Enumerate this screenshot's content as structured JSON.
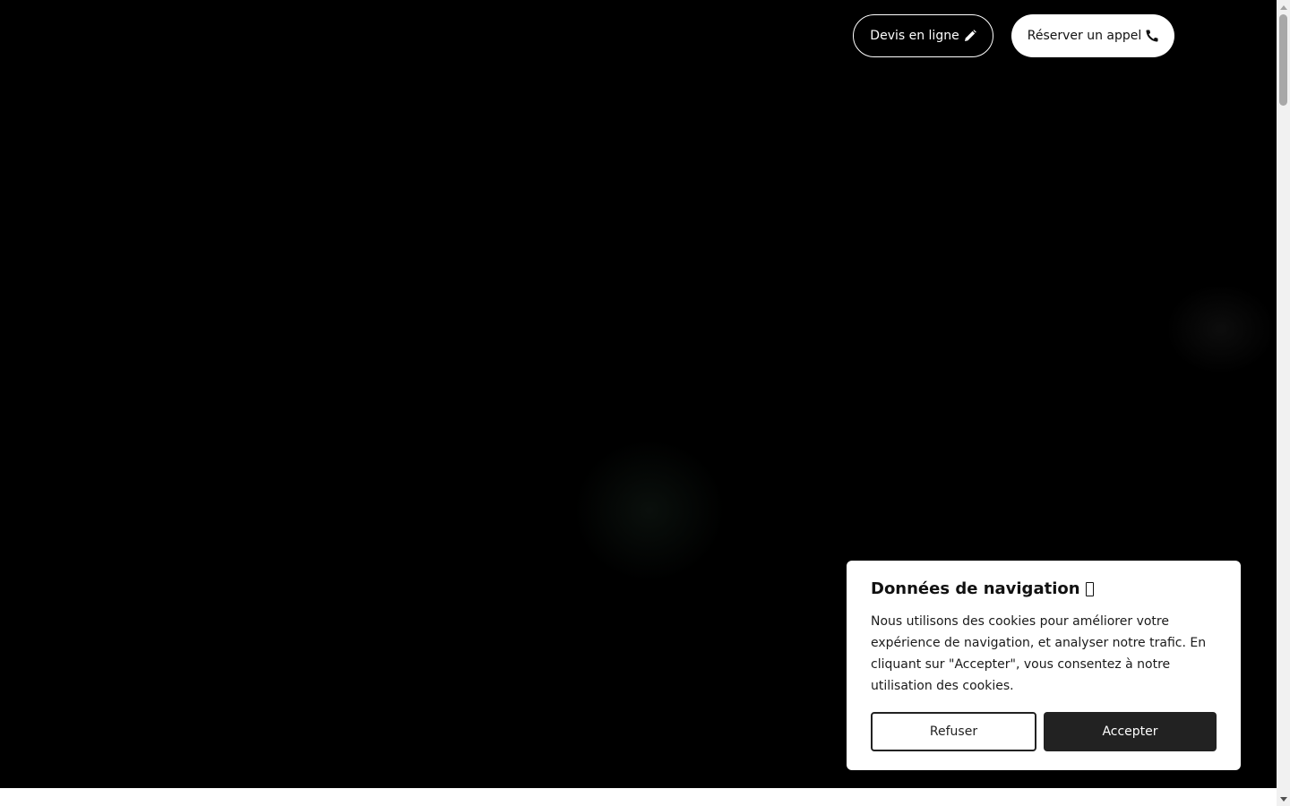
{
  "header": {
    "quote_button_label": "Devis en ligne",
    "quote_button_icon": "pencil-icon",
    "call_button_label": "Réserver un appel",
    "call_button_icon": "phone-icon"
  },
  "cookie_banner": {
    "title": "Données de navigation",
    "message": "Nous utilisons des cookies pour améliorer votre expérience de navigation, et analyser notre trafic. En cliquant sur \"Accepter\", vous consentez à notre utilisation des cookies.",
    "refuse_label": "Refuser",
    "accept_label": "Accepter"
  },
  "colors": {
    "page_background": "#000000",
    "button_dark": "#222222",
    "button_light": "#ffffff"
  }
}
